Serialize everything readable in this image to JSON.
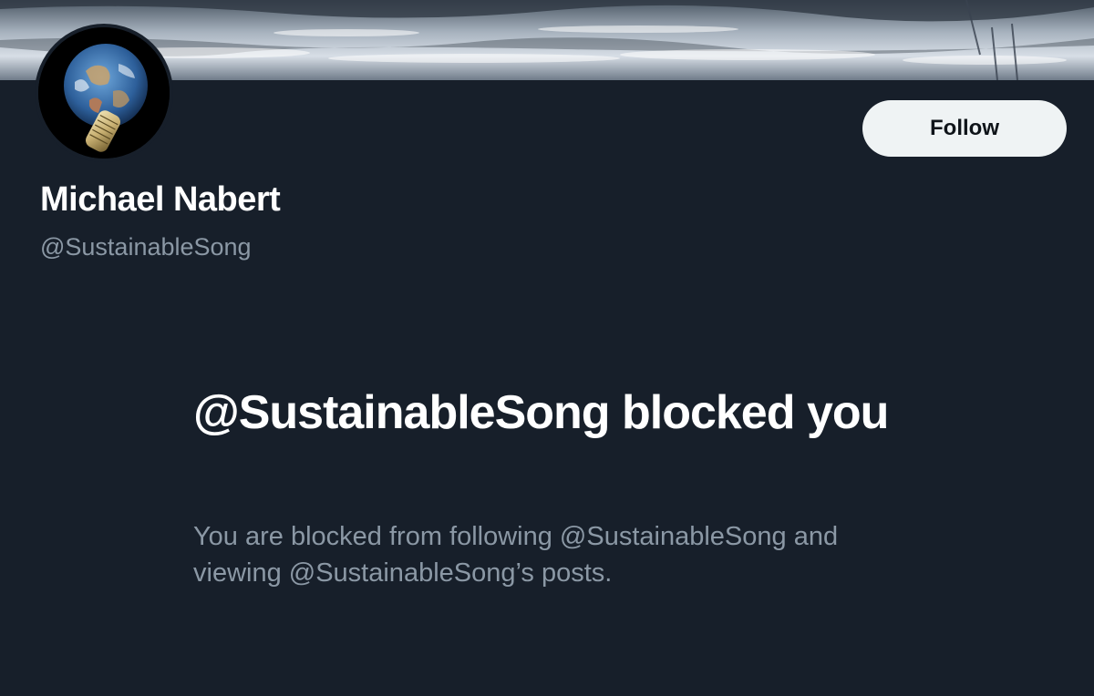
{
  "profile": {
    "display_name": "Michael Nabert",
    "handle": "@SustainableSong"
  },
  "header": {
    "follow_label": "Follow"
  },
  "blocked": {
    "title": "@SustainableSong blocked you",
    "description": "You are blocked from following @SustainableSong and viewing @SustainableSong’s posts."
  },
  "colors": {
    "background": "#171f2a",
    "primary_text": "#ffffff",
    "secondary_text": "#8b98a5",
    "button_bg": "#eff3f4",
    "button_text": "#0f1419"
  }
}
